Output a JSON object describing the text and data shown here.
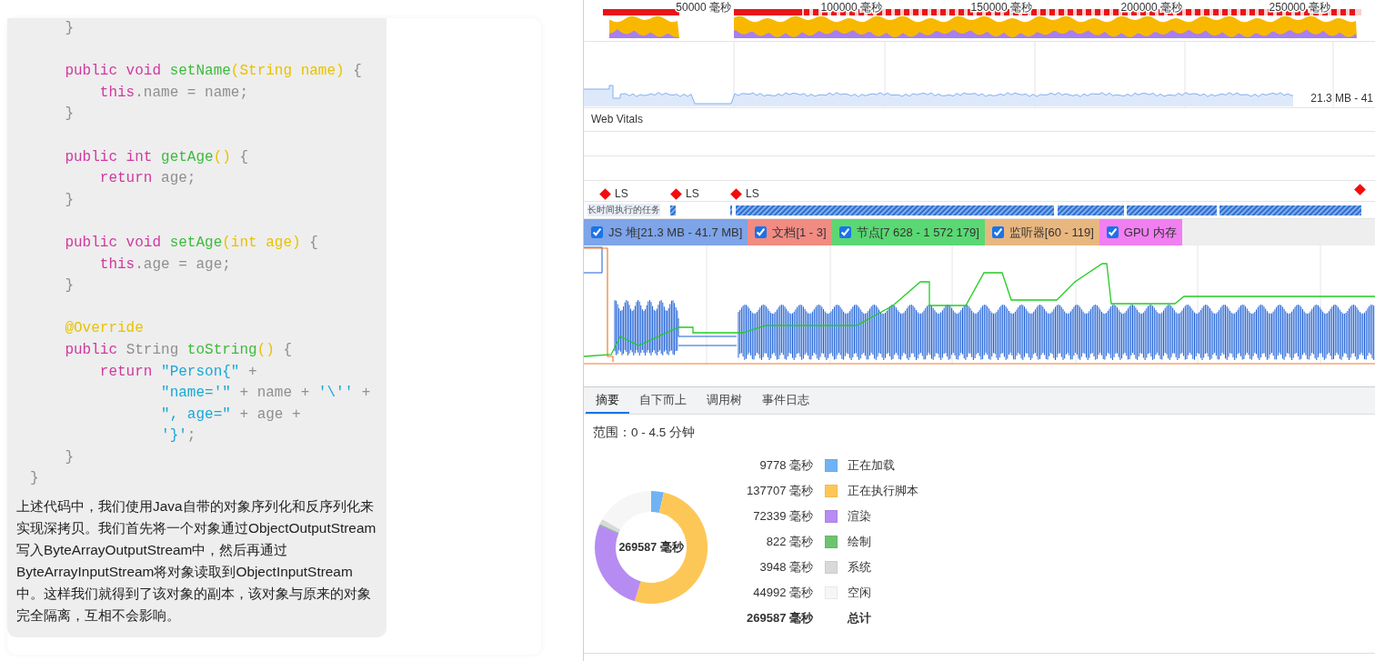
{
  "article": {
    "code_lines": [
      {
        "tokens": [
          {
            "text": "    }",
            "kind": "plain"
          }
        ]
      },
      {
        "blank_before": true,
        "tokens": [
          {
            "text": "    public void ",
            "kind": "kw"
          },
          {
            "text": "setName",
            "kind": "fn"
          },
          {
            "text": "(String name)",
            "kind": "ty"
          },
          {
            "text": " {",
            "kind": "plain"
          }
        ]
      },
      {
        "tokens": [
          {
            "text": "        this",
            "kind": "kw"
          },
          {
            "text": ".name = name;",
            "kind": "plain"
          }
        ]
      },
      {
        "tokens": [
          {
            "text": "    }",
            "kind": "plain"
          }
        ]
      },
      {
        "blank_before": true,
        "tokens": [
          {
            "text": "    public int ",
            "kind": "kw"
          },
          {
            "text": "getAge",
            "kind": "fn"
          },
          {
            "text": "()",
            "kind": "ty"
          },
          {
            "text": " {",
            "kind": "plain"
          }
        ]
      },
      {
        "tokens": [
          {
            "text": "        return ",
            "kind": "kw"
          },
          {
            "text": "age;",
            "kind": "plain"
          }
        ]
      },
      {
        "tokens": [
          {
            "text": "    }",
            "kind": "plain"
          }
        ]
      },
      {
        "blank_before": true,
        "tokens": [
          {
            "text": "    public void ",
            "kind": "kw"
          },
          {
            "text": "setAge",
            "kind": "fn"
          },
          {
            "text": "(int age)",
            "kind": "ty"
          },
          {
            "text": " {",
            "kind": "plain"
          }
        ]
      },
      {
        "tokens": [
          {
            "text": "        this",
            "kind": "kw"
          },
          {
            "text": ".age = age;",
            "kind": "plain"
          }
        ]
      },
      {
        "tokens": [
          {
            "text": "    }",
            "kind": "plain"
          }
        ]
      },
      {
        "blank_before": true,
        "tokens": [
          {
            "text": "    @Override",
            "kind": "ann"
          }
        ]
      },
      {
        "tokens": [
          {
            "text": "    public ",
            "kind": "kw"
          },
          {
            "text": "String ",
            "kind": "plain"
          },
          {
            "text": "toString",
            "kind": "fn"
          },
          {
            "text": "()",
            "kind": "ty"
          },
          {
            "text": " {",
            "kind": "plain"
          }
        ]
      },
      {
        "tokens": [
          {
            "text": "        return ",
            "kind": "kw"
          },
          {
            "text": "\"Person{\"",
            "kind": "str"
          },
          {
            "text": " +",
            "kind": "plain"
          }
        ]
      },
      {
        "tokens": [
          {
            "text": "               \"name='\"",
            "kind": "str"
          },
          {
            "text": " + name + ",
            "kind": "plain"
          },
          {
            "text": "'\\''",
            "kind": "str"
          },
          {
            "text": " +",
            "kind": "plain"
          }
        ]
      },
      {
        "tokens": [
          {
            "text": "               \", age=\"",
            "kind": "str"
          },
          {
            "text": " + age +",
            "kind": "plain"
          }
        ]
      },
      {
        "tokens": [
          {
            "text": "               '}'",
            "kind": "str"
          },
          {
            "text": ";",
            "kind": "plain"
          }
        ]
      },
      {
        "tokens": [
          {
            "text": "    }",
            "kind": "plain"
          }
        ]
      },
      {
        "tokens": [
          {
            "text": "}",
            "kind": "plain"
          }
        ]
      }
    ],
    "paragraph": "上述代码中，我们使用Java自带的对象序列化和反序列化来实现深拷贝。我们首先将一个对象通过ObjectOutputStream写入ByteArrayOutputStream中，然后再通过ByteArrayInputStream将对象读取到ObjectInputStream中。这样我们就得到了该对象的副本，该对象与原来的对象完全隔离，互相不会影响。"
  },
  "performance": {
    "overview": {
      "ticks": [
        "50000 毫秒",
        "100000 毫秒",
        "150000 毫秒",
        "200000 毫秒",
        "250000 毫秒"
      ]
    },
    "memory_track": {
      "range_label": "21.3 MB - 41"
    },
    "web_vitals": {
      "title": "Web Vitals",
      "layout_shifts": [
        {
          "label": "LS"
        },
        {
          "label": "LS"
        },
        {
          "label": "LS"
        }
      ]
    },
    "long_tasks": {
      "label": "长时间执行的任务"
    },
    "counters": [
      {
        "label": "JS 堆[21.3 MB - 41.7 MB]",
        "checked": true,
        "color": "#7ea4e9"
      },
      {
        "label": "文档[1 - 3]",
        "checked": true,
        "color": "#f28b82"
      },
      {
        "label": "节点[7 628 - 1 572 179]",
        "checked": true,
        "color": "#5ad873"
      },
      {
        "label": "监听器[60 - 119]",
        "checked": true,
        "color": "#e8b77f"
      },
      {
        "label": "GPU 内存",
        "checked": true,
        "color": "#f27ff2"
      }
    ],
    "tabs": [
      {
        "label": "摘要",
        "selected": true
      },
      {
        "label": "自下而上",
        "selected": false
      },
      {
        "label": "调用树",
        "selected": false
      },
      {
        "label": "事件日志",
        "selected": false
      }
    ],
    "summary": {
      "range": "范围：0 - 4.5 分钟",
      "center_label": "269587 毫秒",
      "rows": [
        {
          "value": "9778 毫秒",
          "color": "#70b3f5"
        },
        {
          "value": "137707 毫秒",
          "color": "#fdc757"
        },
        {
          "value": "72339 毫秒",
          "color": "#b68cf2"
        },
        {
          "value": "822 毫秒",
          "color": "#6cc46f"
        },
        {
          "value": "3948 毫秒",
          "color": "#d9d9d9"
        },
        {
          "value": "44992 毫秒",
          "color": "#f6f6f6"
        }
      ],
      "total": {
        "value": "269587 毫秒",
        "label": "总计"
      },
      "chart_data": {
        "type": "donut",
        "categories": [
          "正在加载",
          "正在执行脚本",
          "渲染",
          "绘制",
          "系统",
          "空闲"
        ],
        "values": [
          3.63,
          51.08,
          26.83,
          0.3,
          1.46,
          16.7
        ]
      }
    }
  }
}
